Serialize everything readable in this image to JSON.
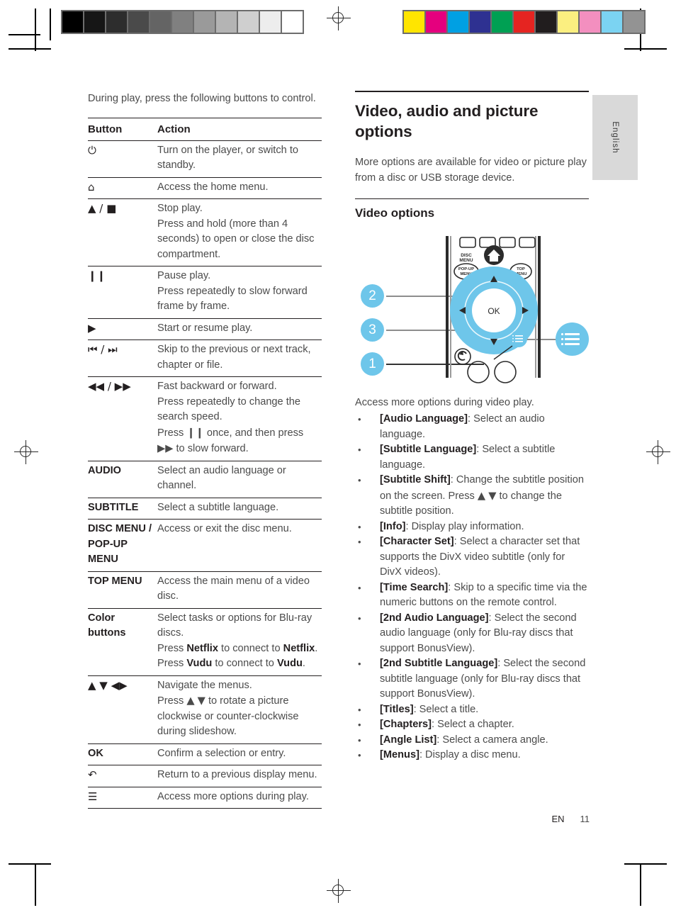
{
  "print_marks": {
    "grayscale_swatches": [
      "#000000",
      "#161616",
      "#2d2d2d",
      "#4a4a4a",
      "#646464",
      "#808080",
      "#9a9a9a",
      "#b4b4b4",
      "#cfcfcf",
      "#ededed",
      "#ffffff"
    ],
    "color_swatches": [
      "#ffe500",
      "#e5007e",
      "#00a0e3",
      "#2e3191",
      "#00a053",
      "#e52421",
      "#211d1e",
      "#fbef80",
      "#f38fbf",
      "#7bd3f2",
      "#939393"
    ]
  },
  "language_tab": {
    "label": "English"
  },
  "left_column": {
    "intro": "During play, press the following buttons to control.",
    "table": {
      "headers": [
        "Button",
        "Action"
      ],
      "rows": [
        {
          "button": "⏻",
          "button_is_symbol": true,
          "actions": [
            "Turn on the player, or switch to standby."
          ]
        },
        {
          "button": "⌂",
          "button_is_symbol": true,
          "actions": [
            "Access the home menu."
          ]
        },
        {
          "button": "▲ / ■",
          "button_is_symbol": true,
          "actions": [
            "Stop play.",
            "Press and hold (more than 4 seconds) to open or close the disc compartment."
          ]
        },
        {
          "button": "❙❙",
          "button_is_symbol": true,
          "actions": [
            "Pause play.",
            "Press repeatedly to slow forward frame by frame."
          ]
        },
        {
          "button": "▶",
          "button_is_symbol": true,
          "actions": [
            "Start or resume play."
          ]
        },
        {
          "button": "⏮ / ⏭",
          "button_is_symbol": true,
          "actions": [
            "Skip to the previous or next track, chapter or file."
          ]
        },
        {
          "button": "◀◀ / ▶▶",
          "button_is_symbol": true,
          "actions": [
            "Fast backward or forward.",
            "Press repeatedly to change the search speed.",
            "Press ❙❙ once, and then press ▶▶ to slow forward."
          ]
        },
        {
          "button": "AUDIO",
          "button_is_symbol": false,
          "actions": [
            "Select an audio language or channel."
          ]
        },
        {
          "button": "SUBTITLE",
          "button_is_symbol": false,
          "actions": [
            "Select a subtitle language."
          ]
        },
        {
          "button": "DISC MENU /\nPOP-UP MENU",
          "button_is_symbol": false,
          "actions": [
            "Access or exit the disc menu."
          ]
        },
        {
          "button": "TOP MENU",
          "button_is_symbol": false,
          "actions": [
            "Access the main menu of a video disc."
          ]
        },
        {
          "button": "Color buttons",
          "button_is_symbol": false,
          "actions": [
            "Select tasks or options for Blu-ray discs.",
            "Press Netflix to connect to Netflix.",
            "Press Vudu to connect to Vudu."
          ]
        },
        {
          "button": "▲ ▼ ◀▶",
          "button_is_symbol": true,
          "actions": [
            "Navigate the menus.",
            "Press ▲ ▼ to rotate a picture clockwise or counter-clockwise during slideshow."
          ]
        },
        {
          "button": "OK",
          "button_is_symbol": false,
          "actions": [
            "Confirm a selection or entry."
          ]
        },
        {
          "button": "↶",
          "button_is_symbol": true,
          "actions": [
            "Return to a previous display menu."
          ]
        },
        {
          "button": "☰",
          "button_is_symbol": true,
          "actions": [
            "Access more options during play."
          ]
        }
      ]
    }
  },
  "right_column": {
    "section_title": "Video, audio and picture options",
    "section_intro": "More options are available for video or picture play from a disc or USB storage device.",
    "subsection_title": "Video options",
    "figure": {
      "callouts": [
        "2",
        "3",
        "1"
      ],
      "remote_labels": {
        "disc_menu": "DISC MENU",
        "popup_menu": "POP-UP MENU",
        "top_menu": "TOP MENU",
        "ok": "OK"
      }
    },
    "list_intro": "Access more options during video play.",
    "bullets": [
      {
        "term": "[Audio Language]",
        "desc": ": Select an audio language."
      },
      {
        "term": "[Subtitle Language]",
        "desc": ": Select a subtitle language."
      },
      {
        "term": "[Subtitle Shift]",
        "desc": ": Change the subtitle position on the screen. Press ▲ ▼ to change the subtitle position."
      },
      {
        "term": "[Info]",
        "desc": ": Display play information."
      },
      {
        "term": "[Character Set]",
        "desc": ": Select a character set that supports the DivX video subtitle (only for DivX videos)."
      },
      {
        "term": "[Time Search]",
        "desc": ": Skip to a specific time via the numeric buttons on the remote control."
      },
      {
        "term": "[2nd Audio Language]",
        "desc": ": Select the second audio language (only for Blu-ray discs that support BonusView)."
      },
      {
        "term": "[2nd Subtitle Language]",
        "desc": ": Select the second subtitle language (only for Blu-ray discs that support BonusView)."
      },
      {
        "term": "[Titles]",
        "desc": ": Select a title."
      },
      {
        "term": "[Chapters]",
        "desc": ": Select a chapter."
      },
      {
        "term": "[Angle List]",
        "desc": ": Select a camera angle."
      },
      {
        "term": "[Menus]",
        "desc": ": Display a disc menu."
      }
    ]
  },
  "footer": {
    "language_code": "EN",
    "page_number": "11"
  },
  "colors": {
    "callout_blue": "#6ec6ea",
    "text_body": "#4b4b4b",
    "text_heading": "#231f20",
    "tab_gray": "#d9d9d9"
  }
}
